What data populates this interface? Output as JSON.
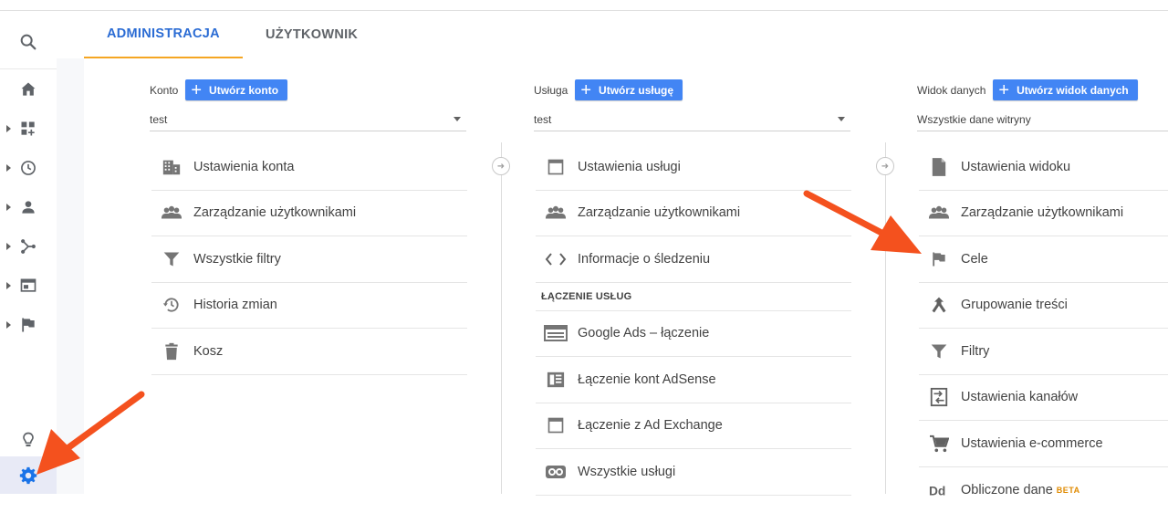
{
  "tabs": [
    {
      "label": "ADMINISTRACJA",
      "active": true
    },
    {
      "label": "UŻYTKOWNIK",
      "active": false
    }
  ],
  "left_nav": {
    "icons": [
      "search-icon",
      "home-icon",
      "dashboard-icon",
      "clock-icon",
      "person-icon",
      "share-icon",
      "display-icon",
      "flag-icon",
      "lightbulb-icon",
      "gear-icon"
    ]
  },
  "account": {
    "label": "Konto",
    "create_button": "Utwórz konto",
    "selected": "test",
    "items": [
      {
        "label": "Ustawienia konta",
        "icon": "building-icon"
      },
      {
        "label": "Zarządzanie użytkownikami",
        "icon": "users-icon"
      },
      {
        "label": "Wszystkie filtry",
        "icon": "filter-icon"
      },
      {
        "label": "Historia zmian",
        "icon": "history-icon"
      },
      {
        "label": "Kosz",
        "icon": "trash-icon"
      }
    ]
  },
  "property": {
    "label": "Usługa",
    "create_button": "Utwórz usługę",
    "selected": "test",
    "items": [
      {
        "label": "Ustawienia usługi",
        "icon": "window-icon"
      },
      {
        "label": "Zarządzanie użytkownikami",
        "icon": "users-icon"
      },
      {
        "label": "Informacje o śledzeniu",
        "icon": "code-icon"
      }
    ],
    "section_title": "ŁĄCZENIE USŁUG",
    "link_items": [
      {
        "label": "Google Ads – łączenie",
        "icon": "ads-icon"
      },
      {
        "label": "Łączenie kont AdSense",
        "icon": "adsense-icon"
      },
      {
        "label": "Łączenie z Ad Exchange",
        "icon": "window-icon"
      },
      {
        "label": "Wszystkie usługi",
        "icon": "link-icon"
      }
    ]
  },
  "view": {
    "label": "Widok danych",
    "create_button": "Utwórz widok danych",
    "selected": "Wszystkie dane witryny",
    "items": [
      {
        "label": "Ustawienia widoku",
        "icon": "document-icon"
      },
      {
        "label": "Zarządzanie użytkownikami",
        "icon": "users-icon"
      },
      {
        "label": "Cele",
        "icon": "flag-icon"
      },
      {
        "label": "Grupowanie treści",
        "icon": "grouping-icon"
      },
      {
        "label": "Filtry",
        "icon": "filter-icon"
      },
      {
        "label": "Ustawienia kanałów",
        "icon": "channels-icon"
      },
      {
        "label": "Ustawienia e-commerce",
        "icon": "cart-icon"
      },
      {
        "label": "Obliczone dane",
        "icon": "calculated-icon"
      }
    ],
    "beta_label": "BETA"
  },
  "colors": {
    "accent": "#2b6cd4",
    "button": "#4285f4",
    "tab_underline": "#f5a623",
    "annotation_arrow": "#f4511e"
  }
}
